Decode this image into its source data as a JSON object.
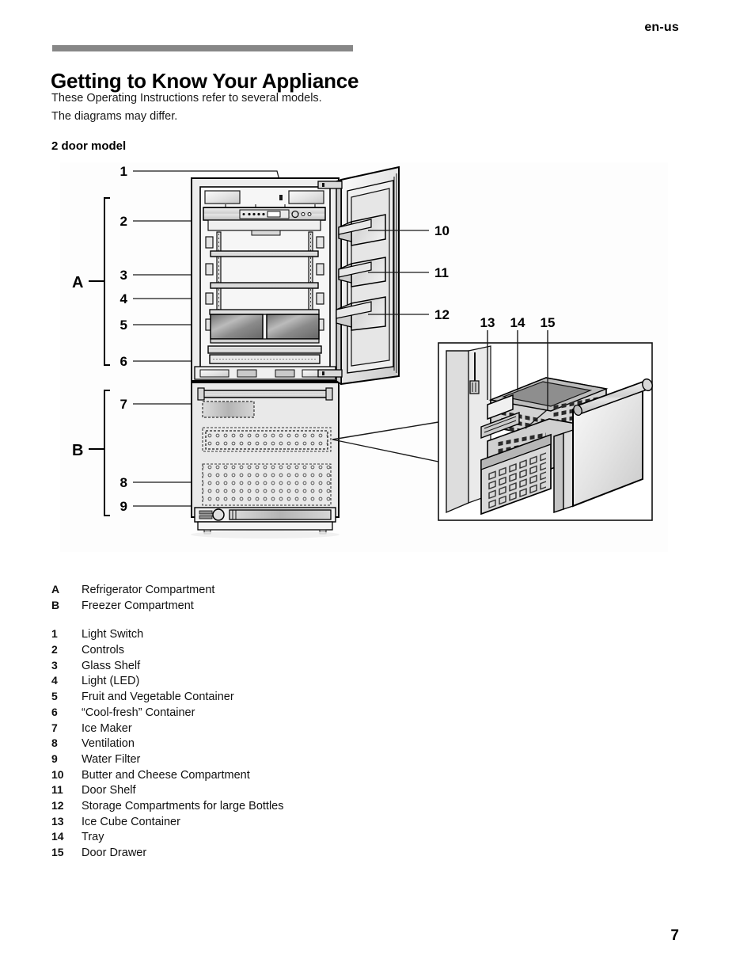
{
  "header": {
    "language_tag": "en-us"
  },
  "title": "Getting to Know Your Appliance",
  "intro": {
    "line1": "These Operating Instructions refer to several models.",
    "line2": "The diagrams may differ."
  },
  "section_heading": "2 door model",
  "figure": {
    "compartment_brackets": [
      {
        "key": "A",
        "name": "refrigerator-compartment-bracket"
      },
      {
        "key": "B",
        "name": "freezer-compartment-bracket"
      }
    ],
    "callouts_left": [
      "1",
      "2",
      "3",
      "4",
      "5",
      "6",
      "7",
      "8",
      "9"
    ],
    "callouts_right": [
      "10",
      "11",
      "12"
    ],
    "callouts_inset": [
      "13",
      "14",
      "15"
    ]
  },
  "legend": {
    "letters": [
      {
        "key": "A",
        "label": "Refrigerator Compartment"
      },
      {
        "key": "B",
        "label": "Freezer Compartment"
      }
    ],
    "numbers": [
      {
        "key": "1",
        "label": "Light Switch"
      },
      {
        "key": "2",
        "label": "Controls"
      },
      {
        "key": "3",
        "label": "Glass Shelf"
      },
      {
        "key": "4",
        "label": "Light (LED)"
      },
      {
        "key": "5",
        "label": "Fruit and Vegetable Container"
      },
      {
        "key": "6",
        "label": "“Cool-fresh” Container"
      },
      {
        "key": "7",
        "label": "Ice Maker"
      },
      {
        "key": "8",
        "label": "Ventilation"
      },
      {
        "key": "9",
        "label": "Water Filter"
      },
      {
        "key": "10",
        "label": "Butter and Cheese Compartment"
      },
      {
        "key": "11",
        "label": "Door Shelf"
      },
      {
        "key": "12",
        "label": "Storage Compartments for large Bottles"
      },
      {
        "key": "13",
        "label": "Ice Cube Container"
      },
      {
        "key": "14",
        "label": "Tray"
      },
      {
        "key": "15",
        "label": "Door Drawer"
      }
    ]
  },
  "footer": {
    "page_number": "7"
  },
  "colors": {
    "rule": "#878787",
    "text": "#000000",
    "line_art": "#000000",
    "panel_light": "#e8e8e8",
    "panel_mid": "#d2d2d2",
    "panel_dark": "#a8a8a8"
  }
}
